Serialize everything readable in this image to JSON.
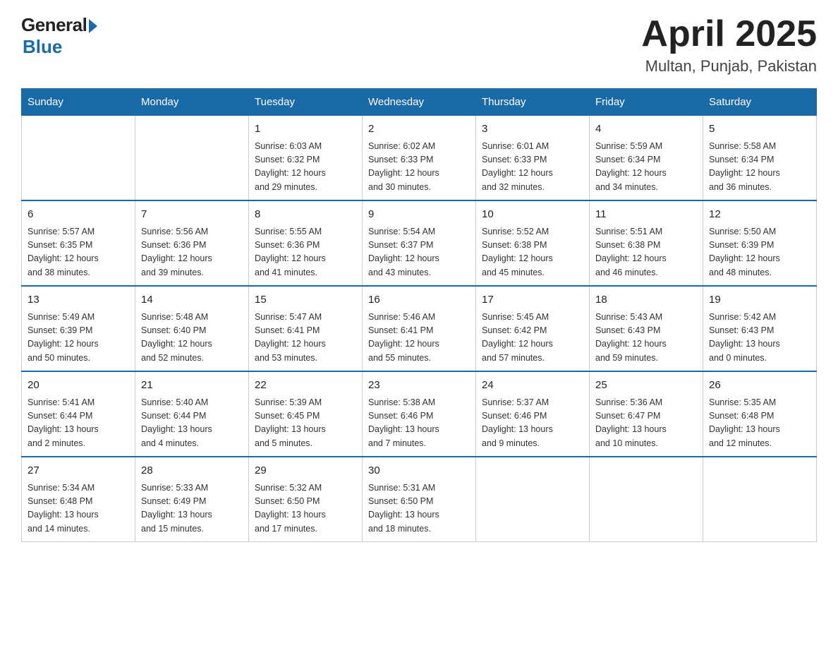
{
  "header": {
    "logo_general": "General",
    "logo_blue": "Blue",
    "title": "April 2025",
    "subtitle": "Multan, Punjab, Pakistan"
  },
  "days_of_week": [
    "Sunday",
    "Monday",
    "Tuesday",
    "Wednesday",
    "Thursday",
    "Friday",
    "Saturday"
  ],
  "weeks": [
    [
      {
        "day": "",
        "info": ""
      },
      {
        "day": "",
        "info": ""
      },
      {
        "day": "1",
        "info": "Sunrise: 6:03 AM\nSunset: 6:32 PM\nDaylight: 12 hours\nand 29 minutes."
      },
      {
        "day": "2",
        "info": "Sunrise: 6:02 AM\nSunset: 6:33 PM\nDaylight: 12 hours\nand 30 minutes."
      },
      {
        "day": "3",
        "info": "Sunrise: 6:01 AM\nSunset: 6:33 PM\nDaylight: 12 hours\nand 32 minutes."
      },
      {
        "day": "4",
        "info": "Sunrise: 5:59 AM\nSunset: 6:34 PM\nDaylight: 12 hours\nand 34 minutes."
      },
      {
        "day": "5",
        "info": "Sunrise: 5:58 AM\nSunset: 6:34 PM\nDaylight: 12 hours\nand 36 minutes."
      }
    ],
    [
      {
        "day": "6",
        "info": "Sunrise: 5:57 AM\nSunset: 6:35 PM\nDaylight: 12 hours\nand 38 minutes."
      },
      {
        "day": "7",
        "info": "Sunrise: 5:56 AM\nSunset: 6:36 PM\nDaylight: 12 hours\nand 39 minutes."
      },
      {
        "day": "8",
        "info": "Sunrise: 5:55 AM\nSunset: 6:36 PM\nDaylight: 12 hours\nand 41 minutes."
      },
      {
        "day": "9",
        "info": "Sunrise: 5:54 AM\nSunset: 6:37 PM\nDaylight: 12 hours\nand 43 minutes."
      },
      {
        "day": "10",
        "info": "Sunrise: 5:52 AM\nSunset: 6:38 PM\nDaylight: 12 hours\nand 45 minutes."
      },
      {
        "day": "11",
        "info": "Sunrise: 5:51 AM\nSunset: 6:38 PM\nDaylight: 12 hours\nand 46 minutes."
      },
      {
        "day": "12",
        "info": "Sunrise: 5:50 AM\nSunset: 6:39 PM\nDaylight: 12 hours\nand 48 minutes."
      }
    ],
    [
      {
        "day": "13",
        "info": "Sunrise: 5:49 AM\nSunset: 6:39 PM\nDaylight: 12 hours\nand 50 minutes."
      },
      {
        "day": "14",
        "info": "Sunrise: 5:48 AM\nSunset: 6:40 PM\nDaylight: 12 hours\nand 52 minutes."
      },
      {
        "day": "15",
        "info": "Sunrise: 5:47 AM\nSunset: 6:41 PM\nDaylight: 12 hours\nand 53 minutes."
      },
      {
        "day": "16",
        "info": "Sunrise: 5:46 AM\nSunset: 6:41 PM\nDaylight: 12 hours\nand 55 minutes."
      },
      {
        "day": "17",
        "info": "Sunrise: 5:45 AM\nSunset: 6:42 PM\nDaylight: 12 hours\nand 57 minutes."
      },
      {
        "day": "18",
        "info": "Sunrise: 5:43 AM\nSunset: 6:43 PM\nDaylight: 12 hours\nand 59 minutes."
      },
      {
        "day": "19",
        "info": "Sunrise: 5:42 AM\nSunset: 6:43 PM\nDaylight: 13 hours\nand 0 minutes."
      }
    ],
    [
      {
        "day": "20",
        "info": "Sunrise: 5:41 AM\nSunset: 6:44 PM\nDaylight: 13 hours\nand 2 minutes."
      },
      {
        "day": "21",
        "info": "Sunrise: 5:40 AM\nSunset: 6:44 PM\nDaylight: 13 hours\nand 4 minutes."
      },
      {
        "day": "22",
        "info": "Sunrise: 5:39 AM\nSunset: 6:45 PM\nDaylight: 13 hours\nand 5 minutes."
      },
      {
        "day": "23",
        "info": "Sunrise: 5:38 AM\nSunset: 6:46 PM\nDaylight: 13 hours\nand 7 minutes."
      },
      {
        "day": "24",
        "info": "Sunrise: 5:37 AM\nSunset: 6:46 PM\nDaylight: 13 hours\nand 9 minutes."
      },
      {
        "day": "25",
        "info": "Sunrise: 5:36 AM\nSunset: 6:47 PM\nDaylight: 13 hours\nand 10 minutes."
      },
      {
        "day": "26",
        "info": "Sunrise: 5:35 AM\nSunset: 6:48 PM\nDaylight: 13 hours\nand 12 minutes."
      }
    ],
    [
      {
        "day": "27",
        "info": "Sunrise: 5:34 AM\nSunset: 6:48 PM\nDaylight: 13 hours\nand 14 minutes."
      },
      {
        "day": "28",
        "info": "Sunrise: 5:33 AM\nSunset: 6:49 PM\nDaylight: 13 hours\nand 15 minutes."
      },
      {
        "day": "29",
        "info": "Sunrise: 5:32 AM\nSunset: 6:50 PM\nDaylight: 13 hours\nand 17 minutes."
      },
      {
        "day": "30",
        "info": "Sunrise: 5:31 AM\nSunset: 6:50 PM\nDaylight: 13 hours\nand 18 minutes."
      },
      {
        "day": "",
        "info": ""
      },
      {
        "day": "",
        "info": ""
      },
      {
        "day": "",
        "info": ""
      }
    ]
  ]
}
